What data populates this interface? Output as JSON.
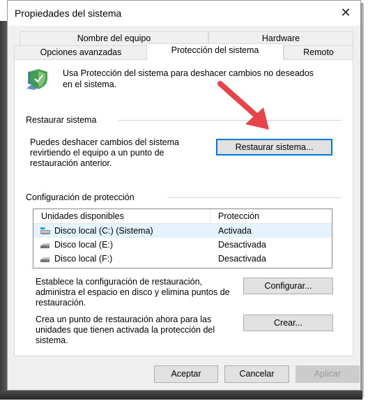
{
  "window": {
    "title": "Propiedades del sistema",
    "close_glyph": "✕"
  },
  "tabs": {
    "row1": [
      "Nombre del equipo",
      "Hardware"
    ],
    "row2": [
      "Opciones avanzadas",
      "Protección del sistema",
      "Remoto"
    ],
    "active": "Protección del sistema"
  },
  "intro": {
    "icon": "system-protection-shield-icon",
    "text_line1": "Usa Protección del sistema para deshacer cambios no deseados",
    "text_line2": "en el sistema."
  },
  "restore": {
    "group_label": "Restaurar sistema",
    "desc_line1": "Puedes deshacer cambios del sistema",
    "desc_line2": "revirtiendo el equipo a un punto de",
    "desc_line3": "restauración anterior.",
    "button_label": "Restaurar sistema..."
  },
  "protection": {
    "group_label": "Configuración de protección",
    "columns": [
      "Unidades disponibles",
      "Protección"
    ],
    "drives": [
      {
        "name": "Disco local (C:) (Sistema)",
        "status": "Activada",
        "icon": "system-drive-icon"
      },
      {
        "name": "Disco local (E:)",
        "status": "Desactivada",
        "icon": "drive-icon"
      },
      {
        "name": "Disco local (F:)",
        "status": "Desactivada",
        "icon": "drive-icon"
      }
    ],
    "configure_line1": "Establece la configuración de restauración,",
    "configure_line2": "administra el espacio en disco y elimina puntos de",
    "configure_line3": "restauración.",
    "configure_button": "Configurar...",
    "create_line1": "Crea un punto de restauración ahora para las",
    "create_line2": "unidades que tienen activada la protección del",
    "create_line3": "sistema.",
    "create_button": "Crear..."
  },
  "footer": {
    "ok": "Aceptar",
    "cancel": "Cancelar",
    "apply": "Aplicar"
  },
  "colors": {
    "annotation_arrow": "#e8454a",
    "focus_border": "#0078d7",
    "selected_row": "#e5f3ff"
  }
}
